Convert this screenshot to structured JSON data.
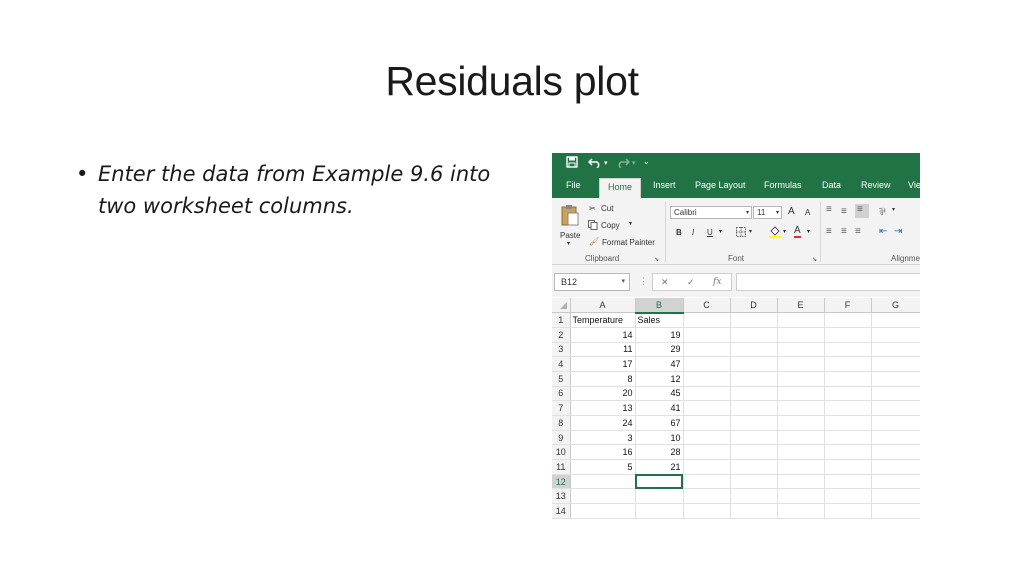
{
  "slide": {
    "title": "Residuals plot",
    "bullet_text": "Enter the data from Example 9.6 into two worksheet columns."
  },
  "excel": {
    "qat": {
      "save_icon": "save-icon",
      "undo_icon": "undo-icon",
      "redo_icon": "redo-icon",
      "dropdown": "⌄"
    },
    "tabs": [
      "File",
      "Home",
      "Insert",
      "Page Layout",
      "Formulas",
      "Data",
      "Review",
      "Vie"
    ],
    "active_tab": "Home",
    "clipboard": {
      "paste": "Paste",
      "cut": "Cut",
      "copy": "Copy",
      "format_painter": "Format Painter",
      "group": "Clipboard"
    },
    "font": {
      "name": "Calibri",
      "size": "11",
      "bold": "B",
      "italic": "I",
      "underline": "U",
      "grow": "A",
      "shrink": "A",
      "color": "A",
      "group": "Font"
    },
    "alignment": {
      "group": "Alignme"
    },
    "name_box": "B12",
    "fx": "fx",
    "columns": [
      "A",
      "B",
      "C",
      "D",
      "E",
      "F",
      "G"
    ],
    "selected_column": "B",
    "selected_row": 12,
    "rows": [
      {
        "n": "1",
        "a": "Temperature",
        "b": "Sales"
      },
      {
        "n": "2",
        "a": "14",
        "b": "19"
      },
      {
        "n": "3",
        "a": "11",
        "b": "29"
      },
      {
        "n": "4",
        "a": "17",
        "b": "47"
      },
      {
        "n": "5",
        "a": "8",
        "b": "12"
      },
      {
        "n": "6",
        "a": "20",
        "b": "45"
      },
      {
        "n": "7",
        "a": "13",
        "b": "41"
      },
      {
        "n": "8",
        "a": "24",
        "b": "67"
      },
      {
        "n": "9",
        "a": "3",
        "b": "10"
      },
      {
        "n": "10",
        "a": "16",
        "b": "28"
      },
      {
        "n": "11",
        "a": "5",
        "b": "21"
      },
      {
        "n": "12",
        "a": "",
        "b": ""
      },
      {
        "n": "13",
        "a": "",
        "b": ""
      },
      {
        "n": "14",
        "a": "",
        "b": ""
      }
    ],
    "colors": {
      "accent": "#217346",
      "ribbon": "#f3f3f3"
    }
  }
}
